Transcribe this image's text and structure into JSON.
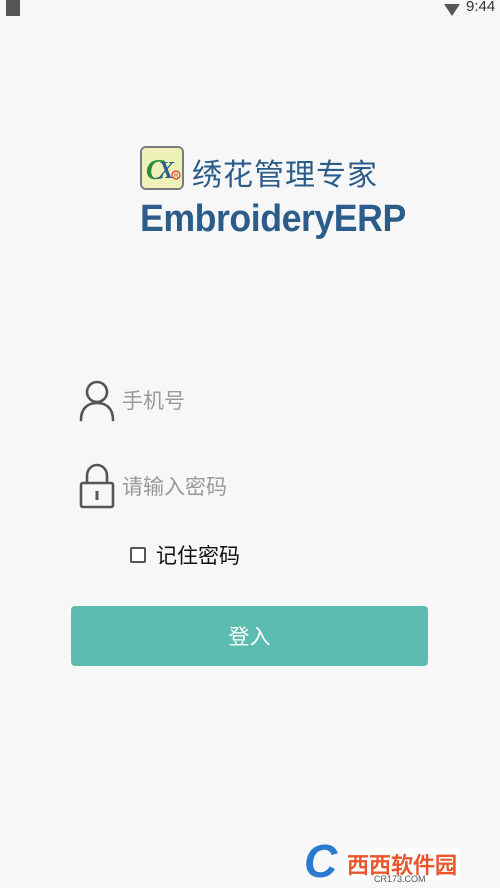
{
  "status_bar": {
    "time": "9:44"
  },
  "brand": {
    "logo_text": "CX",
    "title_cn": "绣花管理专家",
    "title_en": "EmbroideryERP"
  },
  "form": {
    "phone_placeholder": "手机号",
    "password_placeholder": "请输入密码",
    "remember_label": "记住密码",
    "remember_checked": false,
    "login_label": "登入"
  },
  "watermark": {
    "name": "西西软件园",
    "url": "CR173.COM"
  },
  "colors": {
    "accent": "#5cbcb1",
    "brand_text": "#2c5d8a",
    "background": "#f7f7f7"
  }
}
